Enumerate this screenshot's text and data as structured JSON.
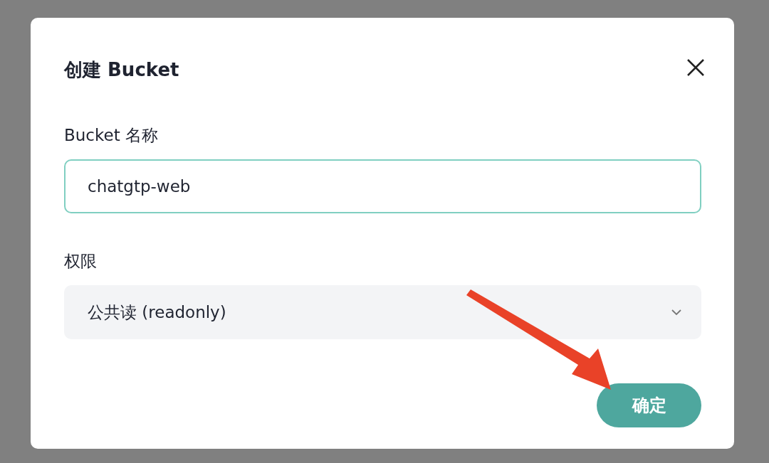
{
  "dialog": {
    "title": "创建 Bucket",
    "fields": [
      {
        "kind": "text",
        "label": "Bucket 名称",
        "value": "chatgtp-web"
      },
      {
        "kind": "select",
        "label": "权限",
        "value": "公共读 (readonly)"
      }
    ],
    "confirm_button": "确定"
  }
}
